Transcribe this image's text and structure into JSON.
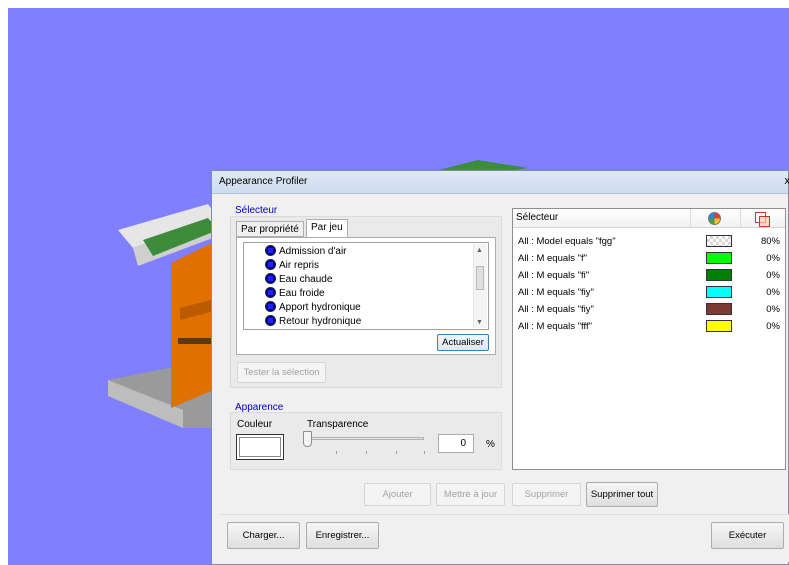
{
  "dialog": {
    "title": "Appearance Profiler",
    "close_label": "x"
  },
  "selector_group": {
    "label": "Sélecteur",
    "tabs": [
      {
        "label": "Par propriété",
        "active": false
      },
      {
        "label": "Par jeu",
        "active": true
      }
    ],
    "items": [
      {
        "label": "Admission d'air",
        "icon": "blue-square-icon"
      },
      {
        "label": "Air repris",
        "icon": "blue-square-icon"
      },
      {
        "label": "Eau chaude",
        "icon": "blue-square-icon"
      },
      {
        "label": "Eau froide",
        "icon": "blue-square-icon"
      },
      {
        "label": "Apport hydronique",
        "icon": "blue-square-icon"
      },
      {
        "label": "Retour hydronique",
        "icon": "blue-square-icon"
      }
    ],
    "refresh_button": "Actualiser",
    "test_button": "Tester la sélection"
  },
  "appearance_group": {
    "label": "Apparence",
    "color_label": "Couleur",
    "transparency_label": "Transparence",
    "transparency_value": "0",
    "transparency_unit": "%",
    "color": "#ffffff"
  },
  "profiles_table": {
    "header_selector": "Sélecteur",
    "header_color_icon": "color-wheel-icon",
    "header_transparency_icon": "transparency-icon",
    "rows": [
      {
        "selector": "All : Model equals \"fgg\"",
        "color": "transparent-checker",
        "transparency": "80%"
      },
      {
        "selector": "All : M equals \"f\"",
        "color": "#00ff00",
        "transparency": "0%"
      },
      {
        "selector": "All : M equals \"fi\"",
        "color": "#008000",
        "transparency": "0%"
      },
      {
        "selector": "All : M equals \"fiy\"",
        "color": "#00ffff",
        "transparency": "0%"
      },
      {
        "selector": "All : M equals \"fiy\"",
        "color": "#7b3b34",
        "transparency": "0%"
      },
      {
        "selector": "All : M equals \"fff\"",
        "color": "#ffff00",
        "transparency": "0%"
      }
    ]
  },
  "actions": {
    "add": "Ajouter",
    "update": "Mettre à jour",
    "delete": "Supprimer",
    "delete_all": "Supprimer tout"
  },
  "footer": {
    "load": "Charger...",
    "save": "Enregistrer...",
    "run": "Exécuter"
  },
  "viewport": {
    "background": "#7f7fff"
  }
}
